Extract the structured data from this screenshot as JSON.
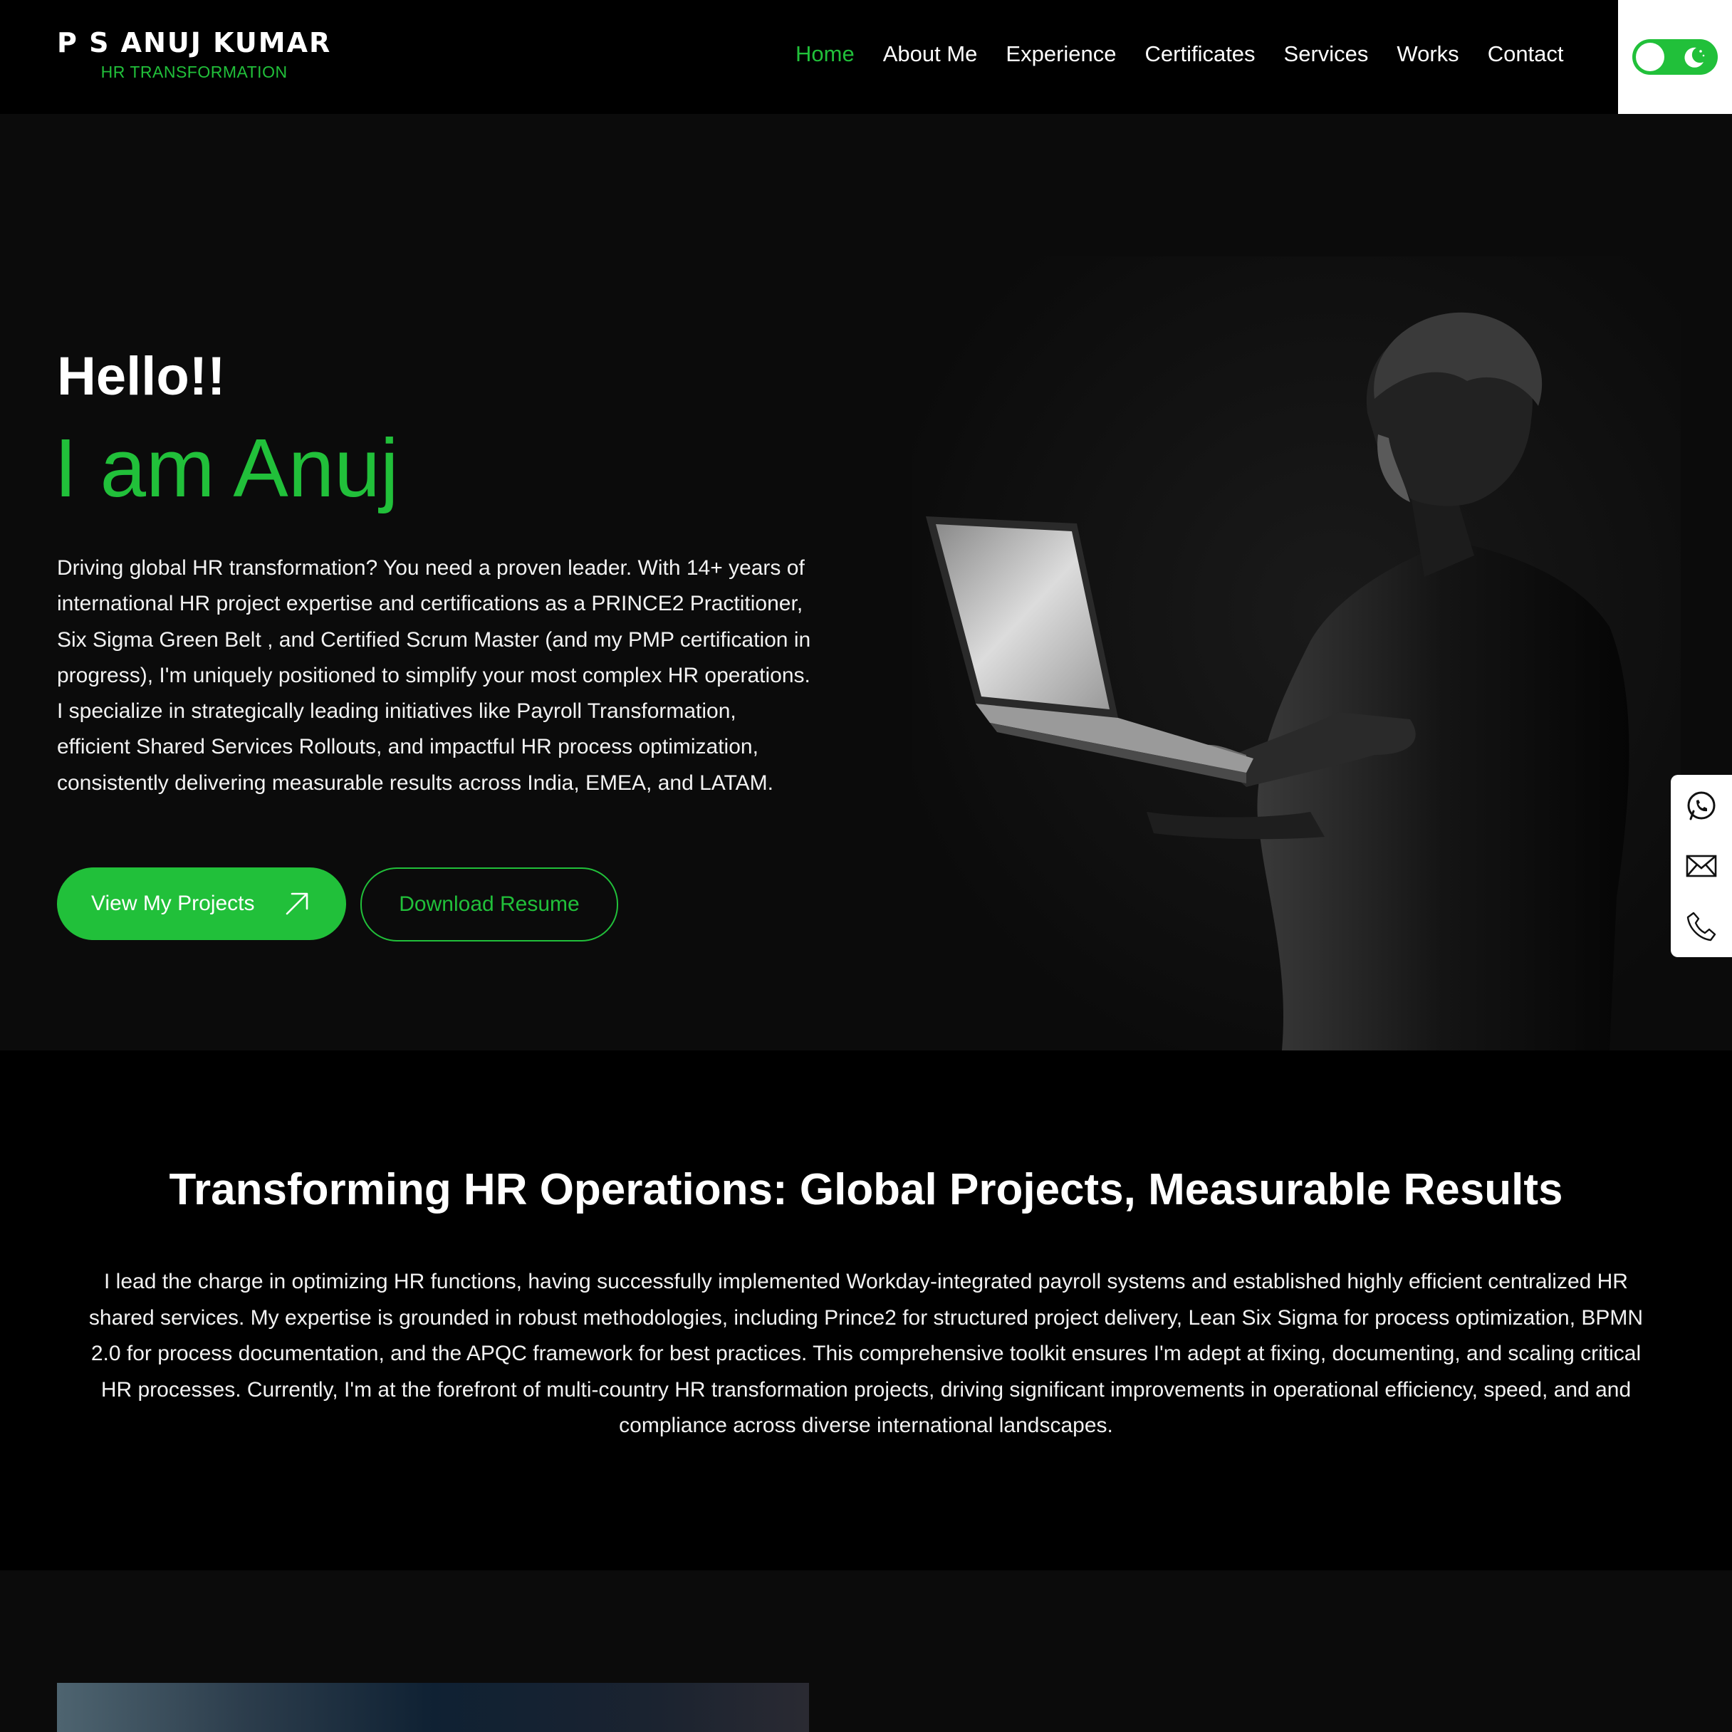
{
  "header": {
    "brand_name": "P S ANUJ KUMAR",
    "brand_subtitle": "HR TRANSFORMATION",
    "nav": [
      {
        "label": "Home",
        "active": true
      },
      {
        "label": "About Me",
        "active": false
      },
      {
        "label": "Experience",
        "active": false
      },
      {
        "label": "Certificates",
        "active": false
      },
      {
        "label": "Services",
        "active": false
      },
      {
        "label": "Works",
        "active": false
      },
      {
        "label": "Contact",
        "active": false
      }
    ],
    "theme_toggle": {
      "icon": "moon-icon",
      "state": "on"
    }
  },
  "hero": {
    "greeting": "Hello!!",
    "headline": "I am Anuj",
    "intro": "Driving global HR transformation? You need a proven leader. With 14+ years of international HR project expertise and certifications as a PRINCE2 Practitioner, Six Sigma Green Belt , and Certified Scrum Master (and my PMP certification in progress), I'm uniquely positioned to simplify your most complex HR operations. I specialize in strategically leading initiatives like Payroll Transformation, efficient Shared Services Rollouts, and impactful HR process optimization, consistently delivering measurable results across India, EMEA, and LATAM.",
    "primary_button": "View My Projects",
    "secondary_button": "Download Resume"
  },
  "side_contact": {
    "icons": [
      "whatsapp-icon",
      "mail-icon",
      "phone-icon"
    ]
  },
  "section2": {
    "title": "Transforming HR Operations: Global Projects, Measurable Results",
    "text": "I lead the charge in optimizing HR functions, having successfully implemented Workday-integrated payroll systems and established highly efficient centralized HR shared services. My expertise is grounded in robust methodologies, including Prince2 for structured project delivery, Lean Six Sigma for process optimization, BPMN 2.0 for process documentation, and the APQC framework for best practices. This comprehensive toolkit ensures I'm adept at fixing, documenting, and scaling critical HR processes. Currently, I'm at the forefront of multi-country HR transformation projects, driving significant improvements in operational efficiency, speed, and and compliance across diverse international landscapes."
  },
  "colors": {
    "accent": "#21c03a",
    "header_bg": "#000000",
    "hero_bg": "#0b0b0b",
    "text": "#ffffff"
  }
}
